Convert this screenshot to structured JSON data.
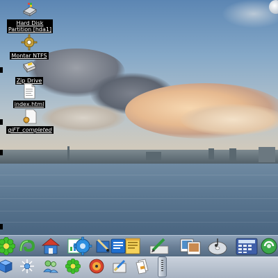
{
  "desktop": {
    "icons": [
      {
        "id": "hard-disk",
        "label": "Hard Disk\nPartition [hda1]",
        "icon": "hard-disk-icon"
      },
      {
        "id": "montar-ntfs",
        "label": "Montar NTFS",
        "icon": "gear-icon"
      },
      {
        "id": "zip-drive",
        "label": "Zip Drive",
        "icon": "zip-drive-icon"
      },
      {
        "id": "index-html",
        "label": "index.html",
        "icon": "html-file-icon"
      },
      {
        "id": "gift-completed",
        "label": "giFT_completed",
        "icon": "folder-icon"
      }
    ]
  },
  "dock": {
    "items": [
      {
        "icon": "icq-flower-icon"
      },
      {
        "icon": "swirl-icon"
      },
      {
        "icon": "home-icon"
      },
      {
        "icon": "chart-document-icon"
      },
      {
        "icon": "settings-gear-icon"
      },
      {
        "icon": "paint-brush-icon"
      },
      {
        "icon": "text-editor-icon"
      },
      {
        "icon": "notes-icon"
      },
      {
        "icon": "pen-write-icon"
      },
      {
        "icon": "image-viewer-icon"
      },
      {
        "icon": "music-cd-icon"
      },
      {
        "icon": "calculator-icon"
      },
      {
        "icon": "recycle-icon"
      }
    ]
  },
  "panel": {
    "items": [
      {
        "icon": "cube-icon"
      },
      {
        "icon": "network-icon"
      },
      {
        "icon": "users-icon"
      },
      {
        "icon": "icq-flower-icon"
      },
      {
        "icon": "media-player-icon"
      },
      {
        "icon": "paint-icon"
      },
      {
        "icon": "documents-icon"
      }
    ]
  },
  "colors": {
    "label_bg": "#000000",
    "label_text": "#ffffff",
    "dock_top": "#8ea2b8",
    "panel_bg": "#c9d1dc"
  }
}
